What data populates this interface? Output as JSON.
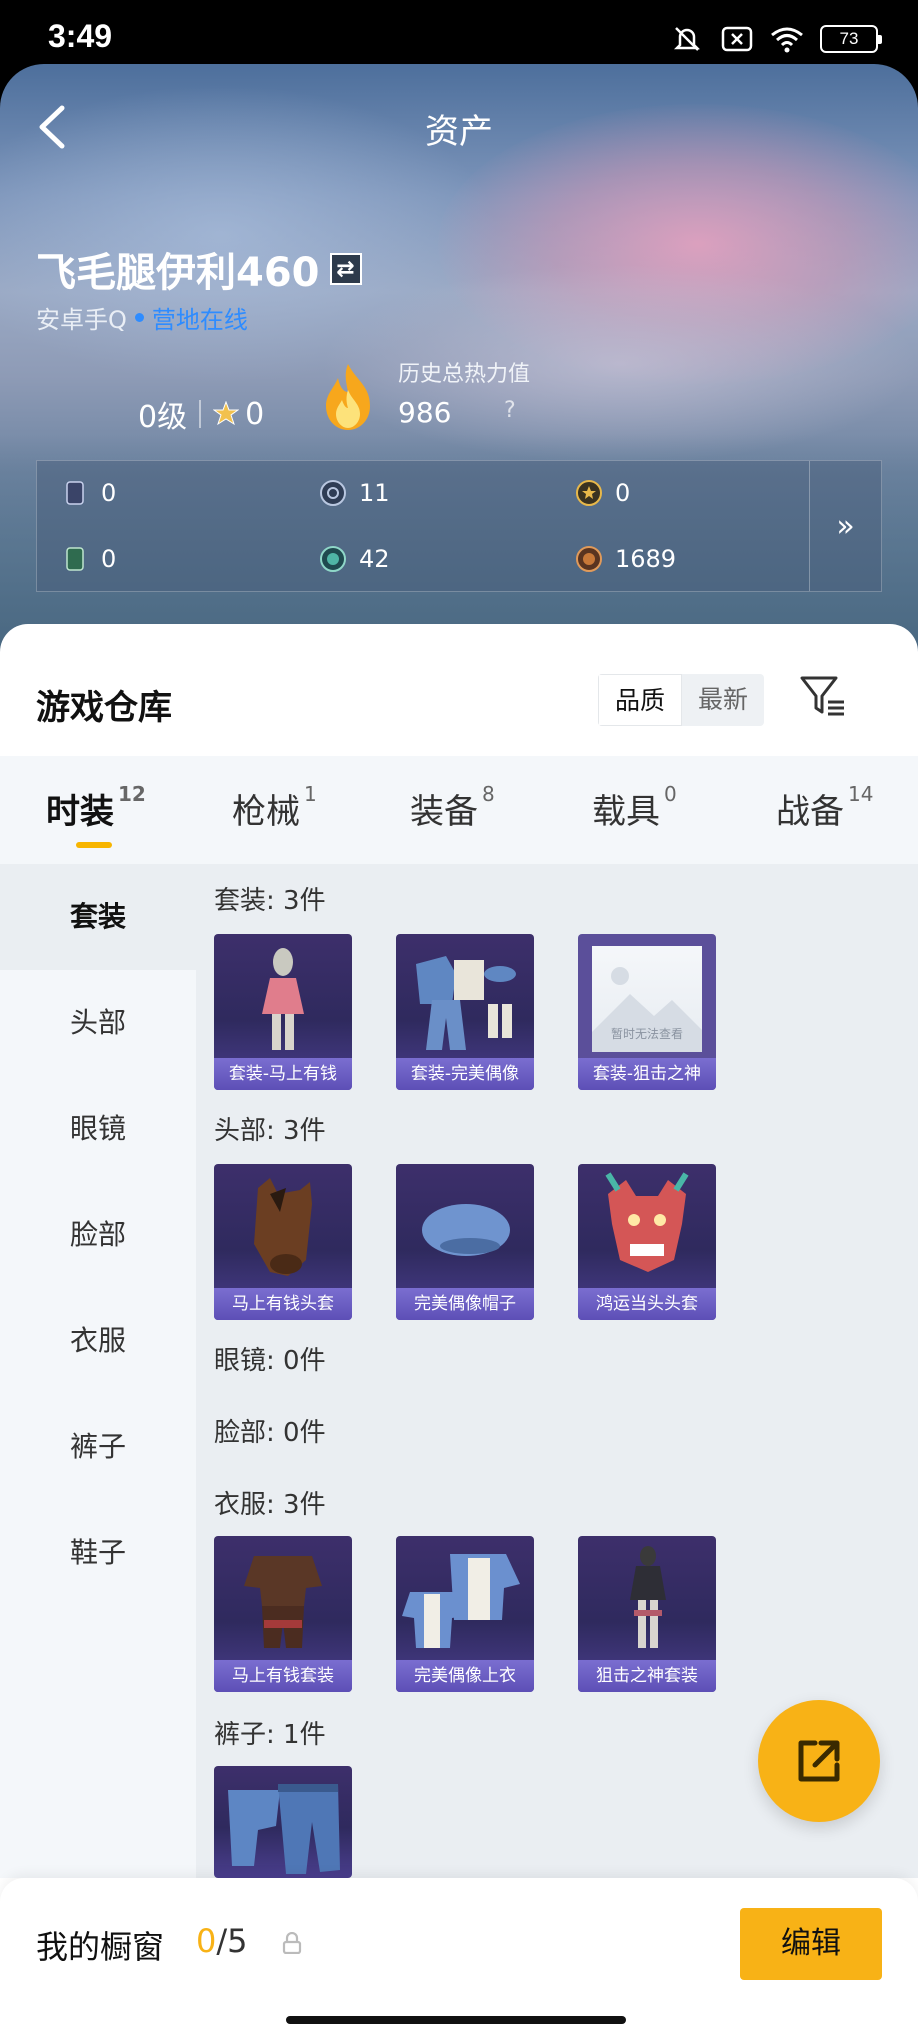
{
  "status": {
    "time": "3:49",
    "battery": "73"
  },
  "nav": {
    "title": "资产"
  },
  "profile": {
    "name": "飞毛腿伊利460",
    "platform": "安卓手Q",
    "online": "营地在线",
    "level": "0级",
    "medal_count": "0",
    "heat_label": "历史总热力值",
    "heat_value": "986",
    "heat_q": "?"
  },
  "resources": [
    {
      "icon": "card-icon",
      "value": "0"
    },
    {
      "icon": "silver-coin-icon",
      "value": "11"
    },
    {
      "icon": "gold-coin-icon",
      "value": "0"
    },
    {
      "icon": "green-card-icon",
      "value": "0"
    },
    {
      "icon": "teal-coin-icon",
      "value": "42"
    },
    {
      "icon": "bronze-coin-icon",
      "value": "1689"
    }
  ],
  "resources_more": "»",
  "warehouse": {
    "title": "游戏仓库",
    "sort_options": [
      "品质",
      "最新"
    ],
    "active_sort": "品质"
  },
  "tabs": [
    {
      "label": "时装",
      "count": "12",
      "active": true
    },
    {
      "label": "枪械",
      "count": "1"
    },
    {
      "label": "装备",
      "count": "8"
    },
    {
      "label": "载具",
      "count": "0"
    },
    {
      "label": "战备",
      "count": "14"
    }
  ],
  "sidebar": [
    "套装",
    "头部",
    "眼镜",
    "脸部",
    "衣服",
    "裤子",
    "鞋子"
  ],
  "sections": {
    "suits": {
      "label": "套装: 3件",
      "items": [
        "套装-马上有钱",
        "套装-完美偶像",
        "套装-狙击之神"
      ],
      "placeholder_text": "暂时无法查看"
    },
    "head": {
      "label": "头部: 3件",
      "items": [
        "马上有钱头套",
        "完美偶像帽子",
        "鸿运当头头套"
      ]
    },
    "glasses": {
      "label": "眼镜: 0件"
    },
    "face": {
      "label": "脸部: 0件"
    },
    "clothes": {
      "label": "衣服: 3件",
      "items": [
        "马上有钱套装",
        "完美偶像上衣",
        "狙击之神套装"
      ]
    },
    "pants": {
      "label": "裤子: 1件"
    }
  },
  "showcase": {
    "label": "我的橱窗",
    "current": "0",
    "total": "/5",
    "edit": "编辑"
  },
  "colors": {
    "accent": "#f8b216",
    "online": "#2e8cff",
    "card_bg": "#3d2f6b",
    "card_caption": "#6a5dc4"
  }
}
